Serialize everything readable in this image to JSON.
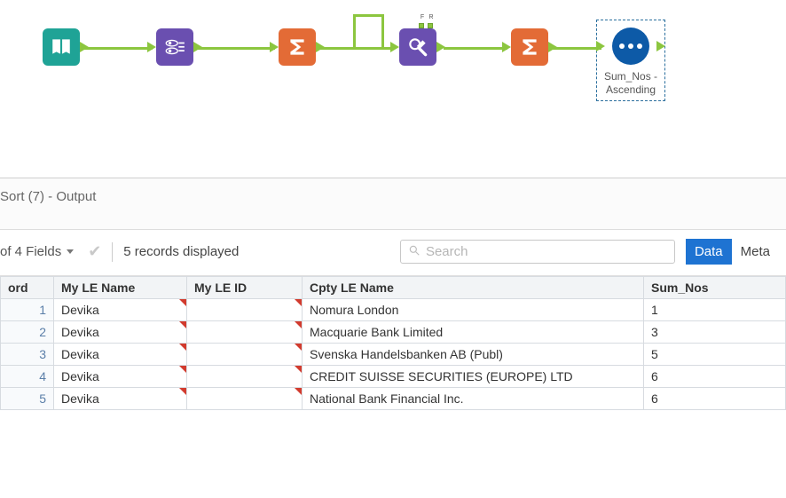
{
  "workflow": {
    "sort_node_caption_line1": "Sum_Nos -",
    "sort_node_caption_line2": "Ascending",
    "port_f": "F",
    "port_r": "R",
    "nodes": [
      {
        "id": "input",
        "icon": "book-open-icon"
      },
      {
        "id": "formula1",
        "icon": "atom-icon"
      },
      {
        "id": "summarize1",
        "icon": "sigma-icon"
      },
      {
        "id": "findreplace",
        "icon": "find-replace-icon"
      },
      {
        "id": "summarize2",
        "icon": "sigma-icon"
      },
      {
        "id": "sort",
        "icon": "dots-icon"
      }
    ]
  },
  "results": {
    "title": "Sort (7) - Output",
    "fields_button": "of 4 Fields",
    "records_text": "5 records displayed",
    "search_placeholder": "Search",
    "tab_data": "Data",
    "tab_meta": "Meta",
    "columns": [
      {
        "key": "record",
        "label": "ord"
      },
      {
        "key": "myle",
        "label": "My LE Name"
      },
      {
        "key": "myleid",
        "label": "My LE ID"
      },
      {
        "key": "cpty",
        "label": "Cpty LE Name"
      },
      {
        "key": "sum",
        "label": "Sum_Nos"
      }
    ],
    "rows": [
      {
        "n": "1",
        "myle": "Devika",
        "myleid": "",
        "cpty": "Nomura London",
        "sum": "1"
      },
      {
        "n": "2",
        "myle": "Devika",
        "myleid": "",
        "cpty": "Macquarie Bank Limited",
        "sum": "3"
      },
      {
        "n": "3",
        "myle": "Devika",
        "myleid": "",
        "cpty": "Svenska Handelsbanken AB (Publ)",
        "sum": "5"
      },
      {
        "n": "4",
        "myle": "Devika",
        "myleid": "",
        "cpty": "CREDIT SUISSE SECURITIES (EUROPE) LTD",
        "sum": "6"
      },
      {
        "n": "5",
        "myle": "Devika",
        "myleid": "",
        "cpty": "National Bank Financial Inc.",
        "sum": "6"
      }
    ]
  }
}
